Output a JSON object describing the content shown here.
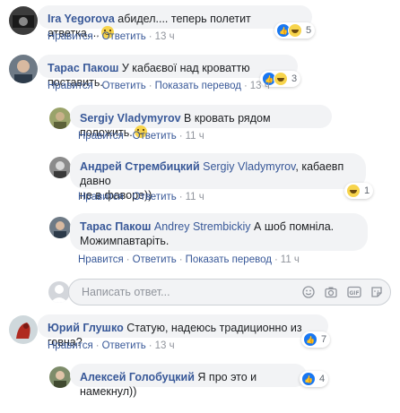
{
  "labels": {
    "like": "Нравится",
    "reply": "Ответить",
    "show_translation": "Показать перевод"
  },
  "comments": [
    {
      "author": "Ira Yegorova",
      "text": "абидел.... теперь полетит атветка....",
      "time": "13 ч",
      "reaction_count": "5"
    },
    {
      "author": "Тарас Пакош",
      "text": "У кабаєвої над кроваттю поставить.",
      "time": "13 ч",
      "reaction_count": "3"
    },
    {
      "author": "Sergiy Vladymyrov",
      "text": "В кровать рядом положить.",
      "time": "11 ч"
    },
    {
      "author": "Андрей Стрембицкий",
      "mention": "Sergiy Vladymyrov",
      "text_line1": ", кабаевп давно",
      "text_line2": "не в фаворе))",
      "time": "11 ч",
      "reaction_count": "1"
    },
    {
      "author": "Тарас Пакош",
      "mention": "Andrey Strembickiy",
      "text_line1": " А шоб помніла.",
      "text_line2": "Можимпавтаріть.",
      "time": "11 ч"
    },
    {
      "author": "Юрий Глушко",
      "text": "Статую, надеюсь традиционно из говна?",
      "time": "13 ч",
      "reaction_count": "7"
    },
    {
      "author": "Алексей Голобуцкий",
      "text": "Я про это и намекнул))",
      "time": "",
      "reaction_count": "4"
    }
  ],
  "reply_input": {
    "placeholder": "Написать ответ..."
  },
  "icons": [
    "smiley-icon",
    "camera-icon",
    "gif-icon",
    "sticker-icon",
    "like-reaction-icon",
    "haha-reaction-icon",
    "smile-emoji-icon"
  ]
}
